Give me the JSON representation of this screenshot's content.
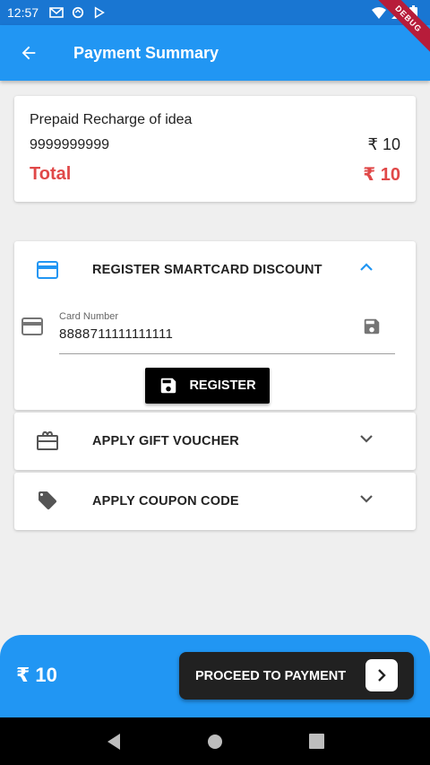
{
  "status_bar": {
    "time": "12:57",
    "debug": "DEBUG"
  },
  "app_bar": {
    "title": "Payment Summary"
  },
  "summary": {
    "title": "Prepaid Recharge of idea",
    "number": "9999999999",
    "amount": "₹ 10",
    "total_label": "Total",
    "total_amount": "₹ 10"
  },
  "smartcard": {
    "label": "REGISTER SMARTCARD DISCOUNT",
    "field_label": "Card Number",
    "field_value": "8888711111111111",
    "register_label": "REGISTER"
  },
  "gift": {
    "label": "APPLY GIFT VOUCHER"
  },
  "coupon": {
    "label": "APPLY COUPON CODE"
  },
  "bottom": {
    "amount": "₹ 10",
    "proceed_label": "PROCEED TO PAYMENT"
  },
  "colors": {
    "primary": "#2196f3",
    "total_red": "#e04848",
    "dark_button": "#212121"
  }
}
